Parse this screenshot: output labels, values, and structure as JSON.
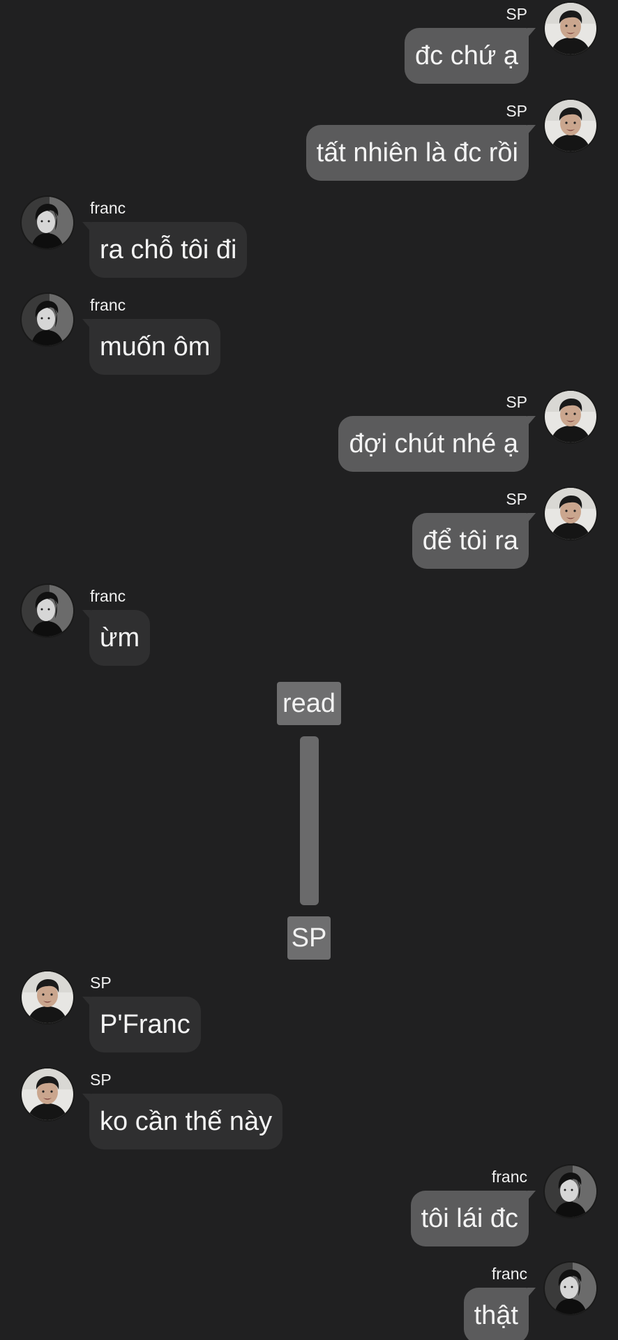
{
  "marker": {
    "read": "read",
    "sender": "SP"
  },
  "messages": [
    {
      "sender": "SP",
      "text": "đc chứ ạ"
    },
    {
      "sender": "SP",
      "text": "tất nhiên là đc rồi"
    },
    {
      "sender": "franc",
      "text": "ra chỗ tôi đi"
    },
    {
      "sender": "franc",
      "text": "muốn ôm"
    },
    {
      "sender": "SP",
      "text": "đợi chút nhé ạ"
    },
    {
      "sender": "SP",
      "text": "để tôi ra"
    },
    {
      "sender": "franc",
      "text": "ừm"
    },
    {
      "sender": "SP",
      "text": "P'Franc"
    },
    {
      "sender": "SP",
      "text": "ko cần thế này"
    },
    {
      "sender": "franc",
      "text": "tôi lái đc"
    },
    {
      "sender": "franc",
      "text": "thật"
    }
  ],
  "avatar_icons": {
    "sp": "sp-avatar-icon",
    "franc": "franc-avatar-icon"
  },
  "colors": {
    "background": "#202021",
    "bubble_left": "#2f2f30",
    "bubble_right": "#5b5b5c",
    "marker": "#6e6e6f",
    "text": "#f4f4f4"
  }
}
